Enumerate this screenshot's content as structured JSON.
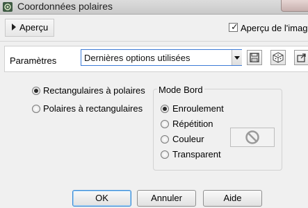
{
  "window": {
    "title": "Coordonnées polaires"
  },
  "preview_bar": {
    "apercu_label": "Aperçu",
    "preview_checkbox_label": "Aperçu de l'imag",
    "preview_checked": true
  },
  "params": {
    "label": "Paramètres",
    "preset_value": "Dernières options utilisées"
  },
  "conversion": {
    "options": [
      "Rectangulaires à polaires",
      "Polaires à rectangulaires"
    ],
    "selected": "Rectangulaires à polaires"
  },
  "mode_bord": {
    "title": "Mode Bord",
    "options": [
      "Enroulement",
      "Répétition",
      "Couleur",
      "Transparent"
    ],
    "selected": "Enroulement"
  },
  "buttons": {
    "ok": "OK",
    "cancel": "Annuler",
    "help": "Aide"
  },
  "icons": {
    "app": "polar-coords-app-icon",
    "save": "save-icon",
    "random": "dice-icon",
    "export": "export-icon",
    "no_color": "no-symbol-icon"
  }
}
